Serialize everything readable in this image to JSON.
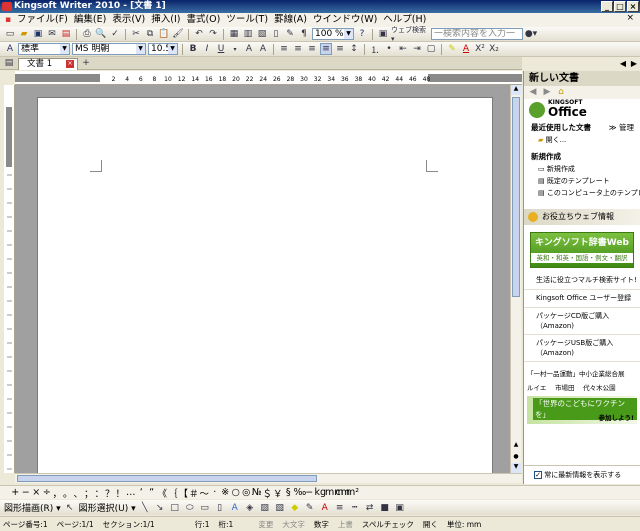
{
  "window": {
    "title": "Kingsoft Writer 2010 - [文書 1]"
  },
  "menu": [
    "ファイル(F)",
    "編集(E)",
    "表示(V)",
    "挿入(I)",
    "書式(O)",
    "ツール(T)",
    "罫線(A)",
    "ウインドウ(W)",
    "ヘルプ(H)"
  ],
  "toolbar1": {
    "zoom": "100 %",
    "search_placeholder": "一検索内容を入力一"
  },
  "toolbar2": {
    "style": "標準",
    "font": "MS 明朝",
    "size": "10.5",
    "bold": "B",
    "italic": "I",
    "underline": "U"
  },
  "tabs": {
    "document": "文書 1"
  },
  "ruler_marks": [
    "2",
    "4",
    "6",
    "8",
    "10",
    "12",
    "14",
    "16",
    "18",
    "20",
    "22",
    "24",
    "26",
    "28",
    "30",
    "32",
    "34",
    "36",
    "38",
    "40",
    "42",
    "44",
    "46",
    "48"
  ],
  "sidepane": {
    "title": "新しい文書",
    "brand_top": "KINGSOFT",
    "brand": "Office",
    "recent_label": "最近使用した文書",
    "manage_label": "≫ 管理",
    "recent_item": "開く...",
    "new_label": "新規作成",
    "new_items": [
      "新規作成",
      "既定のテンプレート",
      "このコンピュータ上のテンプレート"
    ],
    "web_info": "お役立ちウェブ情報",
    "banner_title": "キングソフト辞書Web",
    "banner_sub": "英和・和英・国語・例文・翻訳",
    "links": [
      "生活に役立つマルチ検索サイト!",
      "Kingsoft Office ユーザー登録",
      "パッケージCD版ご購入（Amazon)",
      "パッケージUSB版ご購入（Amazon)"
    ],
    "ticker1": "「一村一品運動」中小企業総合展",
    "ticker2": "ルイエ　 市場田　 代々木公園",
    "vaccine": "「世界のこどもにワクチンを」",
    "vaccine_sub": "参加しよう!",
    "checkbox_label": "常に最新情報を表示する"
  },
  "symbols": [
    "+",
    "−",
    "×",
    "÷",
    "，",
    "。",
    "、",
    "；",
    "：",
    "？",
    "！",
    "…",
    "‘",
    "“",
    "《",
    "｛",
    "【",
    "＃",
    "〜",
    "·",
    "※",
    "○",
    "◎",
    "№",
    "＄",
    "￥",
    "§",
    "‰",
    "−",
    "kg",
    "mm",
    "cm",
    "m²"
  ],
  "drawbar": {
    "draw": "図形描画(R) ▾",
    "select": "図形選択(U) ▾"
  },
  "status": {
    "page": "ページ番号:1",
    "pages": "ページ:1/1",
    "section": "セクション:1/1",
    "row": "行:1",
    "col": "桁:1",
    "mode1": "変更",
    "mode2": "大文字",
    "mode3": "数字",
    "mode4": "上書",
    "spell": "スペルチェック",
    "spell_state": "開く",
    "unit": "単位: mm"
  },
  "colors": {
    "titlebar": "#0a246a",
    "pane_green": "#4a9a1a"
  }
}
